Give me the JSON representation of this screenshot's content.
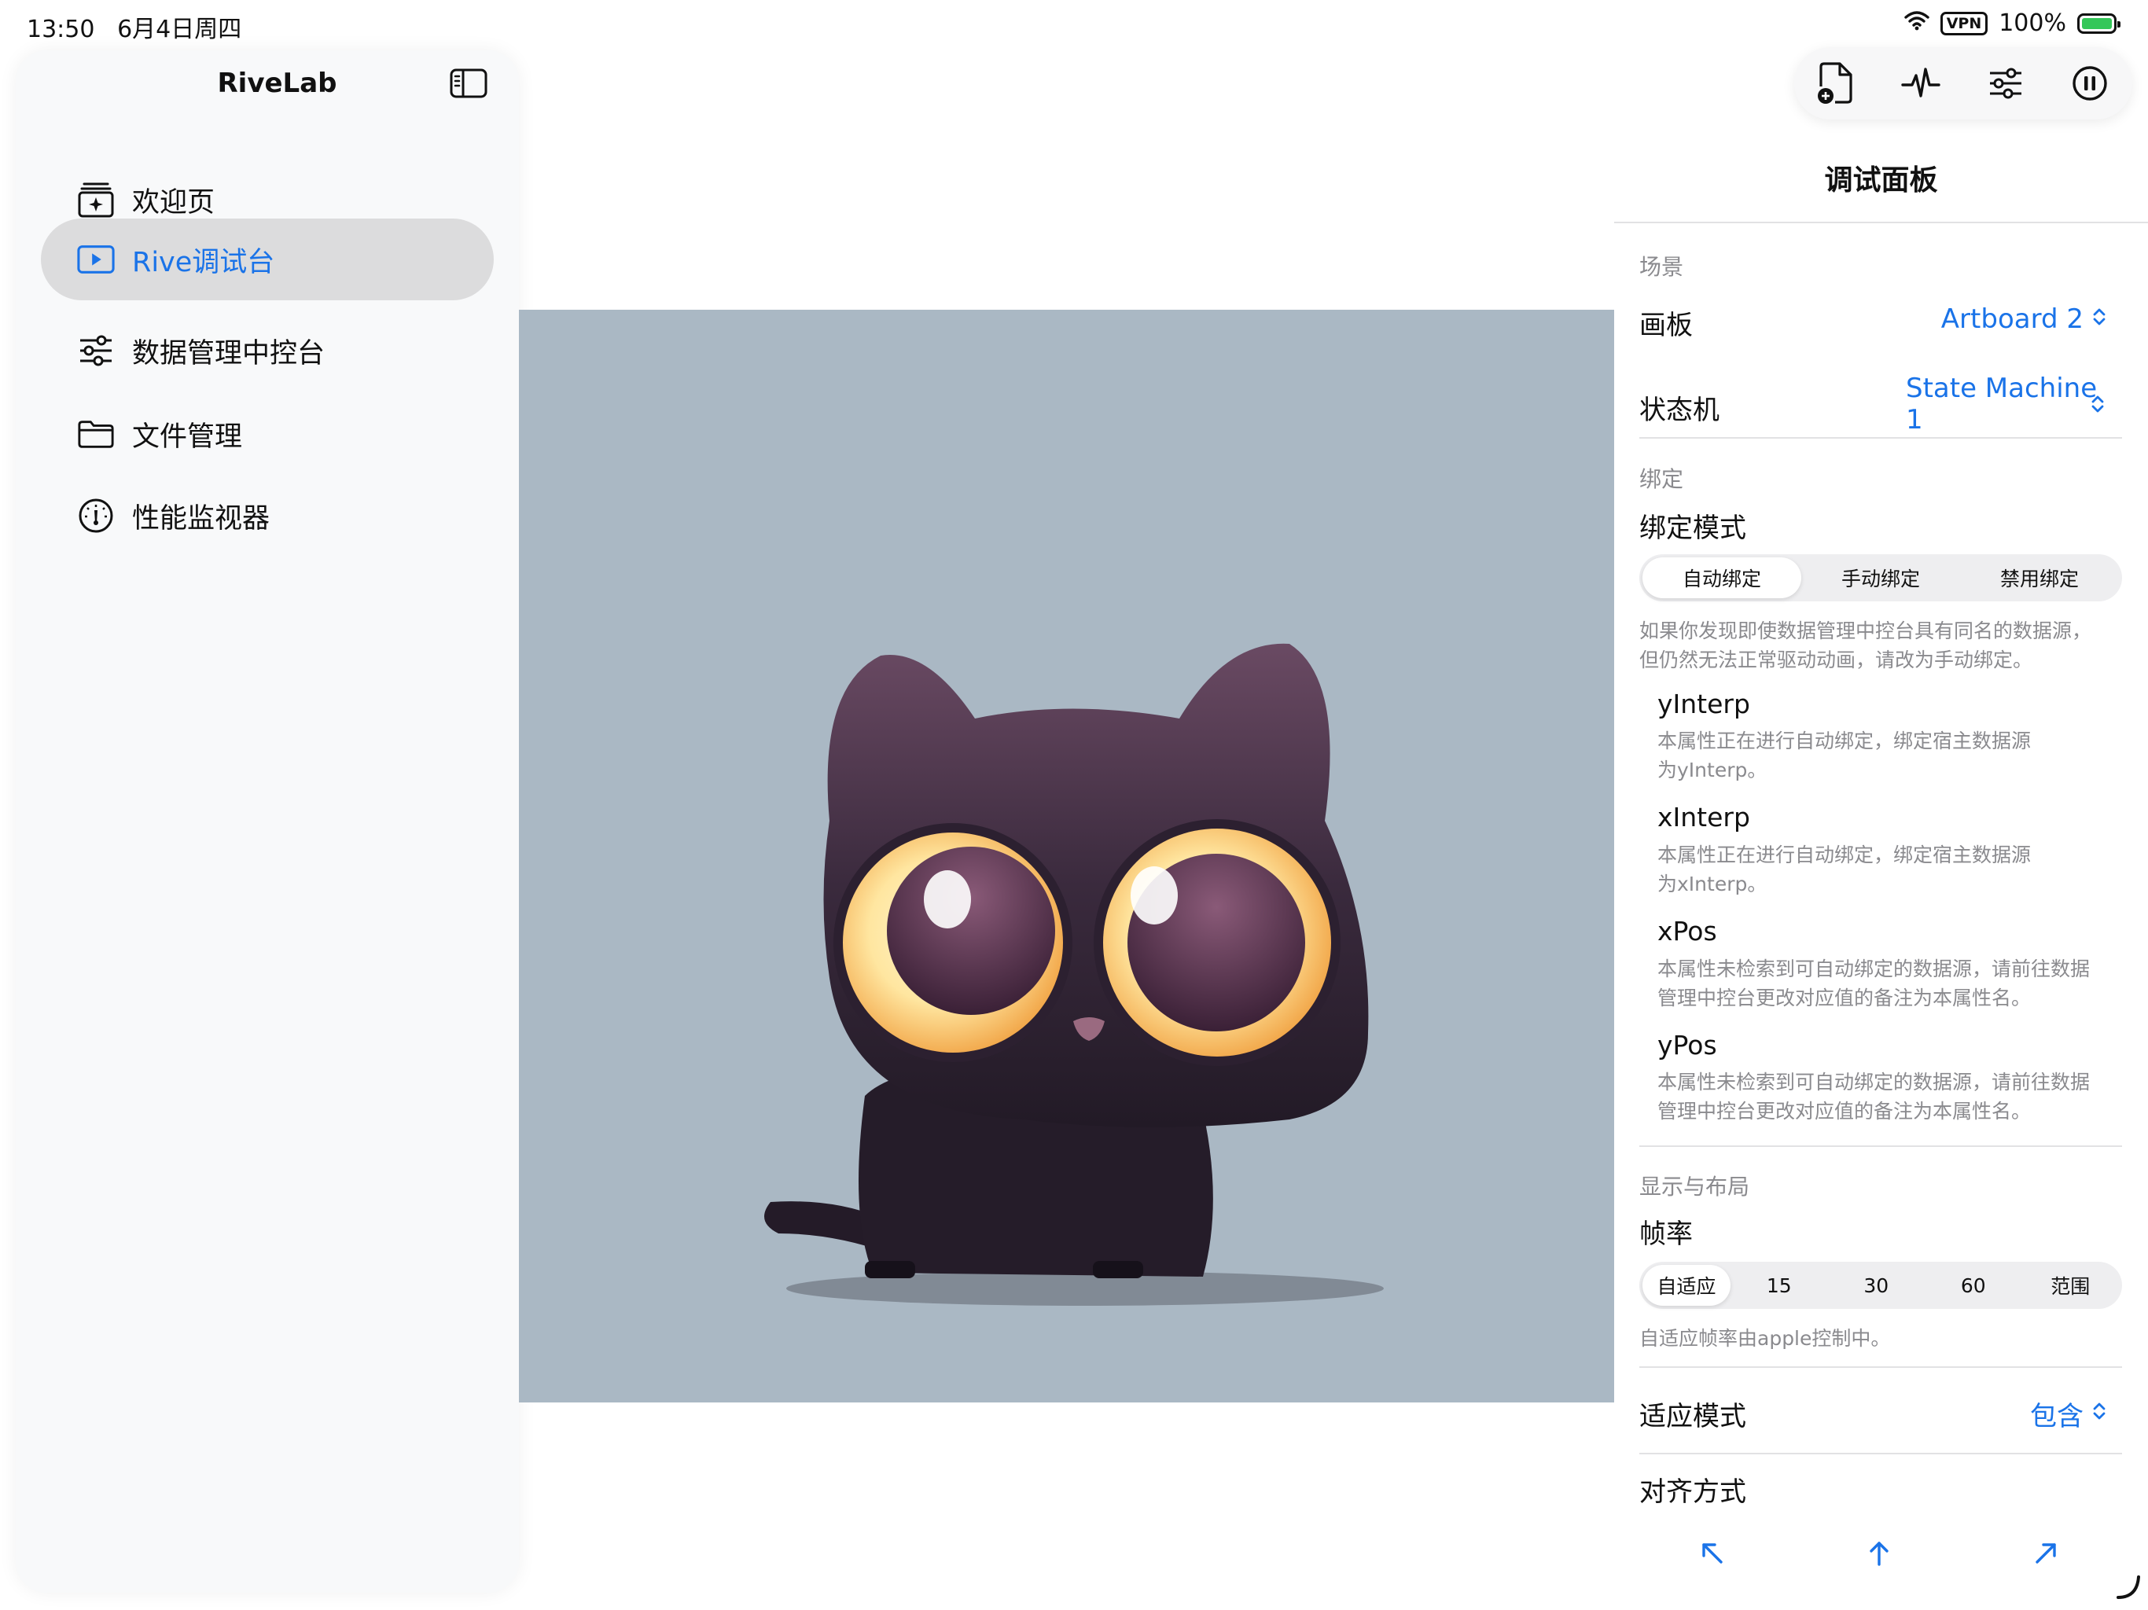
{
  "status": {
    "time": "13:50",
    "date": "6月4日周四",
    "vpn": "VPN",
    "battery": "100%"
  },
  "sidebar": {
    "title": "RiveLab",
    "items": [
      {
        "label": "欢迎页",
        "icon": "sparkle-doc-icon",
        "active": false
      },
      {
        "label": "Rive调试台",
        "icon": "play-rect-icon",
        "active": true
      },
      {
        "label": "数据管理中控台",
        "icon": "sliders-icon",
        "active": false
      },
      {
        "label": "文件管理",
        "icon": "folder-icon",
        "active": false
      },
      {
        "label": "性能监视器",
        "icon": "gauge-icon",
        "active": false
      }
    ]
  },
  "toolbar": {
    "buttons": [
      "new-file-icon",
      "waveform-icon",
      "sliders-icon",
      "pause-icon"
    ]
  },
  "panel": {
    "title": "调试面板",
    "scene": {
      "header": "场景",
      "artboard_label": "画板",
      "artboard_value": "Artboard 2",
      "state_machine_label": "状态机",
      "state_machine_value_line1": "State Machine",
      "state_machine_value_line2": "1"
    },
    "binding": {
      "header": "绑定",
      "mode_label": "绑定模式",
      "modes": [
        "自动绑定",
        "手动绑定",
        "禁用绑定"
      ],
      "selected_mode": "自动绑定",
      "note_line1": "如果你发现即使数据管理中控台具有同名的数据源，",
      "note_line2": "但仍然无法正常驱动动画，请改为手动绑定。",
      "properties": [
        {
          "name": "yInterp",
          "desc_line1": "本属性正在进行自动绑定，绑定宿主数据源",
          "desc_line2": "为yInterp。"
        },
        {
          "name": "xInterp",
          "desc_line1": "本属性正在进行自动绑定，绑定宿主数据源",
          "desc_line2": "为xInterp。"
        },
        {
          "name": "xPos",
          "desc_line1": "本属性未检索到可自动绑定的数据源，请前往数据",
          "desc_line2": "管理中控台更改对应值的备注为本属性名。"
        },
        {
          "name": "yPos",
          "desc_line1": "本属性未检索到可自动绑定的数据源，请前往数据",
          "desc_line2": "管理中控台更改对应值的备注为本属性名。"
        }
      ]
    },
    "display": {
      "header": "显示与布局",
      "framerate_label": "帧率",
      "framerates": [
        "自适应",
        "15",
        "30",
        "60",
        "范围"
      ],
      "selected_framerate": "自适应",
      "framerate_note": "自适应帧率由apple控制中。",
      "fit_label": "适应模式",
      "fit_value": "包含",
      "align_label": "对齐方式",
      "align_buttons": [
        "arrow-up-left-icon",
        "arrow-up-icon",
        "arrow-up-right-icon"
      ]
    }
  },
  "colors": {
    "accent": "#1a73e8",
    "canvas_bg": "#aab8c4",
    "sidebar_bg": "#f8f9fa",
    "active_item_bg": "#dcdcdd"
  }
}
